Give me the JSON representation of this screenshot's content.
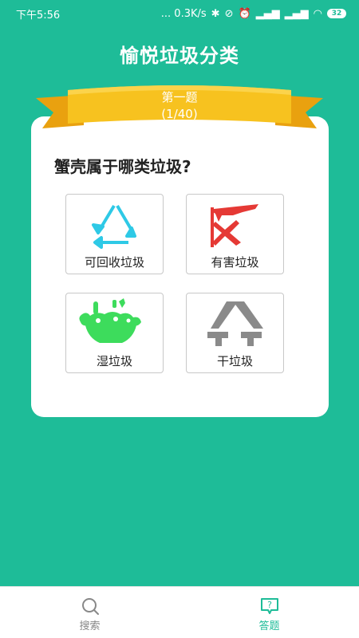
{
  "status_bar": {
    "time": "下午5:56",
    "network_speed": "... 0.3K/s",
    "battery": "32"
  },
  "app": {
    "title": "愉悦垃圾分类"
  },
  "quiz": {
    "ribbon_title": "第一题",
    "progress": "(1/40)",
    "question": "蟹壳属于哪类垃圾?"
  },
  "options": [
    {
      "label": "可回收垃圾",
      "icon": "recycle-icon",
      "color": "#2ec9e6"
    },
    {
      "label": "有害垃圾",
      "icon": "hazardous-icon",
      "color": "#e53935"
    },
    {
      "label": "湿垃圾",
      "icon": "wet-waste-icon",
      "color": "#3ddc5c"
    },
    {
      "label": "干垃圾",
      "icon": "dry-waste-icon",
      "color": "#8a8a8a"
    }
  ],
  "bottom_nav": [
    {
      "label": "搜索",
      "icon": "search-icon",
      "active": false
    },
    {
      "label": "答题",
      "icon": "quiz-icon",
      "active": true
    }
  ],
  "colors": {
    "background": "#1ebc98",
    "ribbon": "#f7b915",
    "accent": "#1ebc98"
  }
}
